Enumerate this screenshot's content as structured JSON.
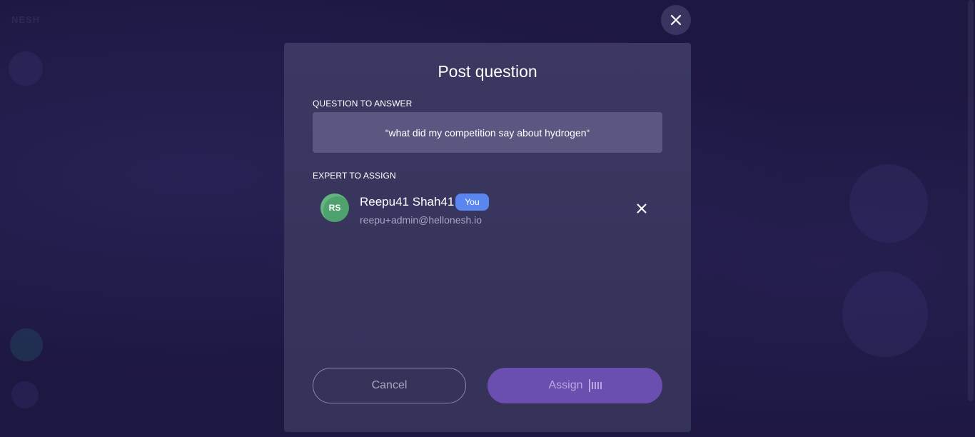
{
  "app": {
    "brand": "NESH"
  },
  "modal": {
    "title": "Post question",
    "question_label": "QUESTION TO ANSWER",
    "question_text": "“what did my competition say about hydrogen“",
    "expert_label": "EXPERT TO ASSIGN",
    "expert": {
      "initials": "RS",
      "name": "Reepu41 Shah41",
      "badge": "You",
      "email": "reepu+admin@hellonesh.io",
      "avatar_color": "#4fa26e"
    },
    "cancel_label": "Cancel",
    "assign_label": "Assign"
  },
  "icons": {
    "close": "close-icon",
    "remove": "remove-expert-icon",
    "loading": "loading-icon"
  },
  "colors": {
    "backdrop": "#1d1842",
    "modal": "#3a3761",
    "badge": "#5a86f0",
    "assign": "#6b4fb0"
  }
}
